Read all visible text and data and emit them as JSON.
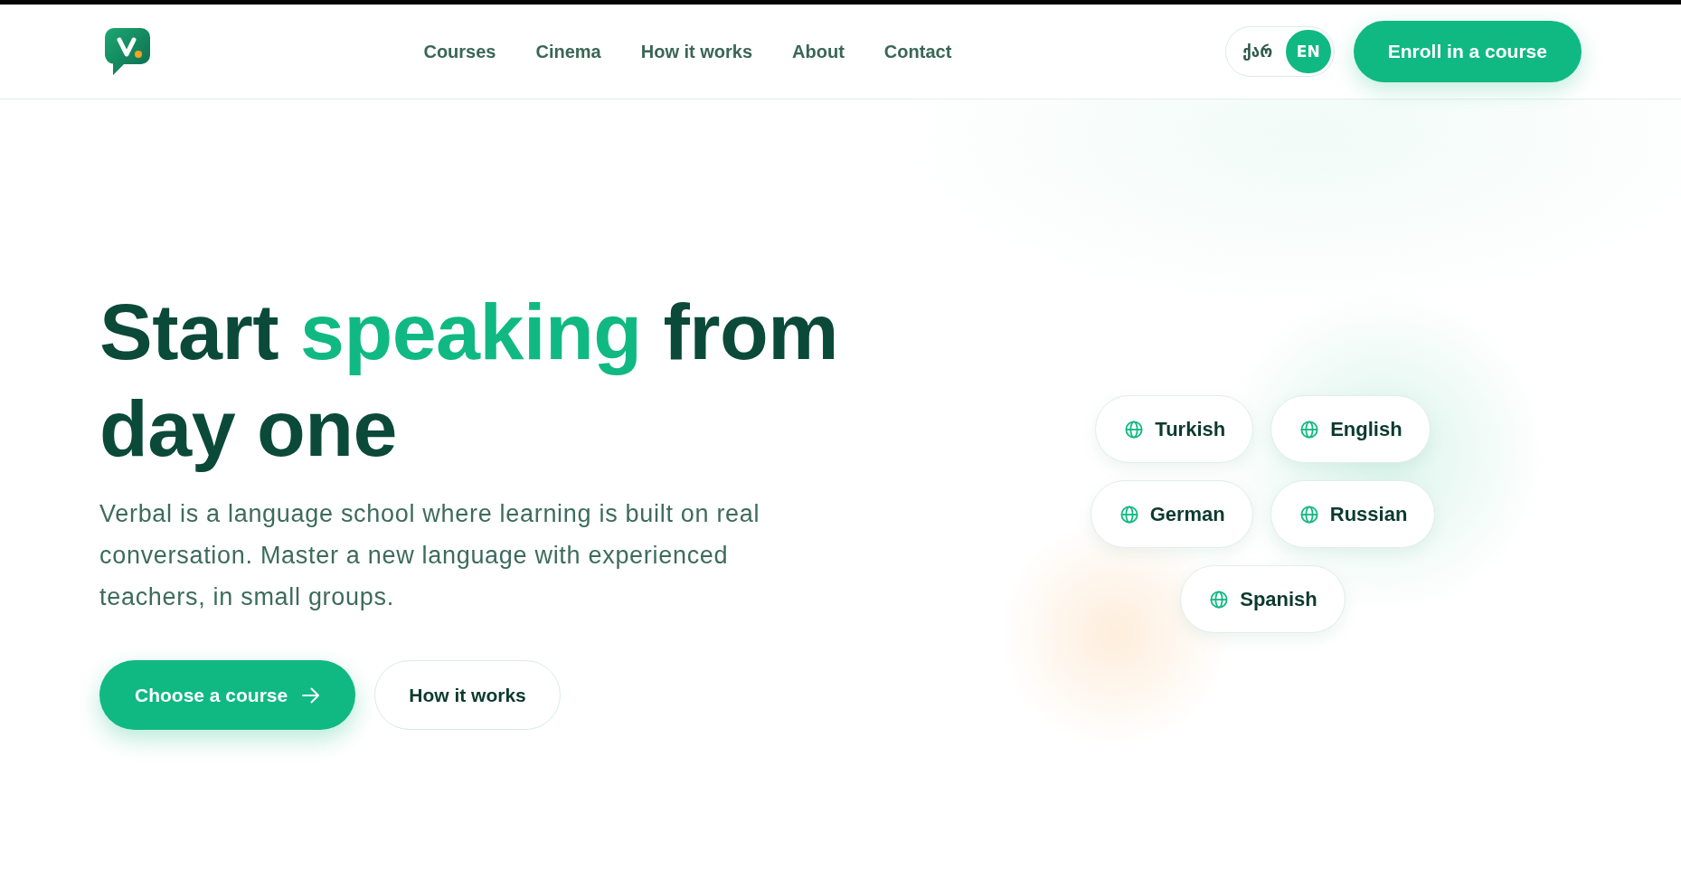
{
  "nav": {
    "links": [
      "Courses",
      "Cinema",
      "How it works",
      "About",
      "Contact"
    ]
  },
  "language_switch": [
    {
      "label": "ქარ",
      "selected": false
    },
    {
      "label": "EN",
      "selected": true
    }
  ],
  "enroll_button": {
    "label": "Enroll in a course"
  },
  "hero": {
    "headline": [
      {
        "text": "Start ",
        "highlight": false
      },
      {
        "text": "speaking",
        "highlight": true
      },
      {
        "text": " from day one",
        "highlight": false
      }
    ],
    "description": "Verbal is a language school where learning is built on real conversation. Master a new language with experienced teachers, in small groups.",
    "buttons": [
      {
        "label": "Choose a course",
        "kind": "primary"
      },
      {
        "label": "How it works",
        "kind": "secondary"
      }
    ]
  },
  "languages": [
    "Turkish",
    "English",
    "German",
    "Russian",
    "Spanish"
  ]
}
